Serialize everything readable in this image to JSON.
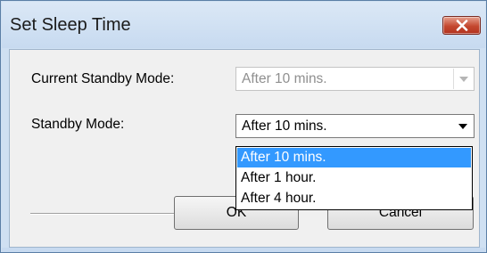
{
  "window": {
    "title": "Set Sleep Time"
  },
  "current_standby": {
    "label": "Current Standby Mode:",
    "value": "After 10 mins.",
    "disabled": true
  },
  "standby": {
    "label": "Standby Mode:",
    "value": "After 10 mins."
  },
  "dropdown": {
    "options": [
      {
        "label": "After 10 mins.",
        "selected": true
      },
      {
        "label": "After 1 hour.",
        "selected": false
      },
      {
        "label": "After 4 hour.",
        "selected": false
      }
    ]
  },
  "buttons": {
    "ok_label": "OK",
    "cancel_label": "Cancel"
  },
  "colors": {
    "selection": "#3399ff",
    "close_button": "#c4482f"
  },
  "icons": {
    "close": "close-icon",
    "dropdown_arrow": "chevron-down-icon"
  }
}
